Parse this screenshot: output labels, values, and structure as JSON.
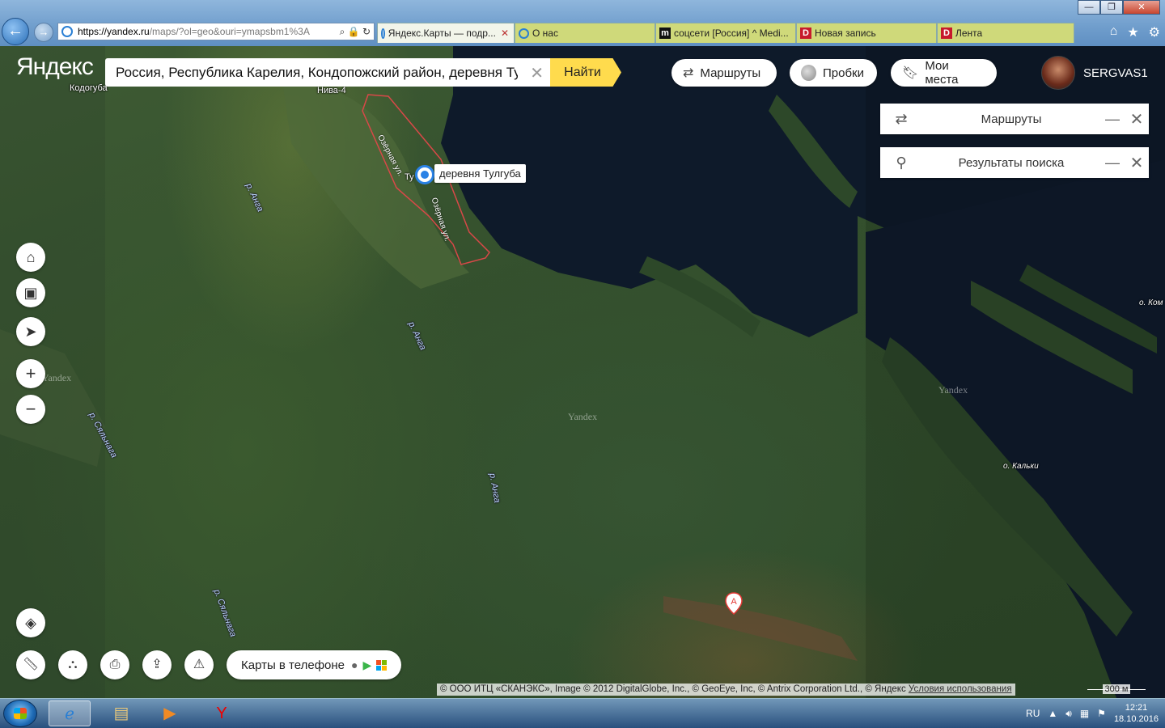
{
  "browser": {
    "url_host": "https://yandex.ru",
    "url_rest": "/maps/?ol=geo&ouri=ymapsbm1%3A",
    "tabs": [
      {
        "label": "Яндекс.Карты — подр...",
        "icon": "ie",
        "active": true
      },
      {
        "label": "О нас",
        "icon": "ie",
        "active": false
      },
      {
        "label": "соцсети [Россия] ^ Medi...",
        "icon": "m",
        "active": false
      },
      {
        "label": "Новая запись",
        "icon": "d",
        "active": false
      },
      {
        "label": "Лента",
        "icon": "d",
        "active": false
      }
    ],
    "win": {
      "minimize": "—",
      "maximize": "❐",
      "close": "✕"
    }
  },
  "header": {
    "logo": "Яндекс",
    "search_value": "Россия, Республика Карелия, Кондопожский район, деревня Тулгуба",
    "find_label": "Найти",
    "routes_label": "Маршруты",
    "traffic_label": "Пробки",
    "places_label": "Мои места",
    "username": "SERGVAS1"
  },
  "panels": {
    "routes": "Маршруты",
    "results": "Результаты поиска"
  },
  "map": {
    "place_pin_label": "деревня Тулгуба",
    "labels": {
      "kodoguba": "Кодогуба",
      "niva": "Нива-4",
      "street1": "Озёрная ул.",
      "street2": "Озёрная ул.",
      "tu": "Ту",
      "anga1": "р. Анга",
      "anga2": "р. Анга",
      "anga3": "р. Анга",
      "syalnaga1": "р. Сяльнага",
      "syalnaga2": "р. Сяльнага",
      "kom": "о. Ком",
      "kalki": "о. Кальки",
      "wm1": "Yandex",
      "wm2": "Yandex",
      "wm3": "Yandex",
      "marker_a": "A"
    }
  },
  "bottom": {
    "app_label": "Карты в телефоне",
    "attribution": "© ООО ИТЦ «СКАНЭКС», Image © 2012 DigitalGlobe, Inc., © GeoEye, Inc, © Antrix Corporation Ltd., © Яндекс",
    "terms": "Условия использования",
    "scale": "300 м"
  },
  "taskbar": {
    "lang": "RU",
    "time": "12:21",
    "date": "18.10.2016"
  }
}
